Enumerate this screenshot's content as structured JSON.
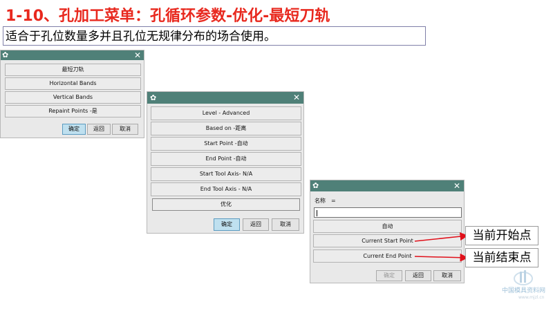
{
  "page": {
    "title": "1-10、孔加工菜单：孔循环参数-优化-最短刀轨",
    "description": "适合于孔位数量多并且孔位无规律分布的场合使用。"
  },
  "dialog1": {
    "menu": [
      "最短刀轨",
      "Horizontal Bands",
      "Vertical Bands",
      "Repaint Points -是"
    ],
    "buttons": {
      "ok": "确定",
      "back": "返回",
      "cancel": "取消"
    }
  },
  "dialog2": {
    "menu": [
      "Level - Advanced",
      "Based on -距离",
      "Start Point -自动",
      "End Point -自动",
      "Start Tool Axis- N/A",
      "End Tool Axis - N/A",
      "优化"
    ],
    "buttons": {
      "ok": "确定",
      "back": "返回",
      "cancel": "取消"
    }
  },
  "dialog3": {
    "name_label": "名称　=",
    "name_value": "",
    "menu": [
      "自动",
      "Current Start Point",
      "Current End Point"
    ],
    "buttons": {
      "ok": "确定",
      "back": "返回",
      "cancel": "取消"
    }
  },
  "callouts": {
    "start": "当前开始点",
    "end": "当前结束点"
  },
  "watermark": {
    "text": "中国模具资料网",
    "url": "www.mjzl.cn"
  },
  "colors": {
    "title": "#e8281e",
    "titlebar": "#4f8078",
    "arrow": "#e0101a"
  }
}
